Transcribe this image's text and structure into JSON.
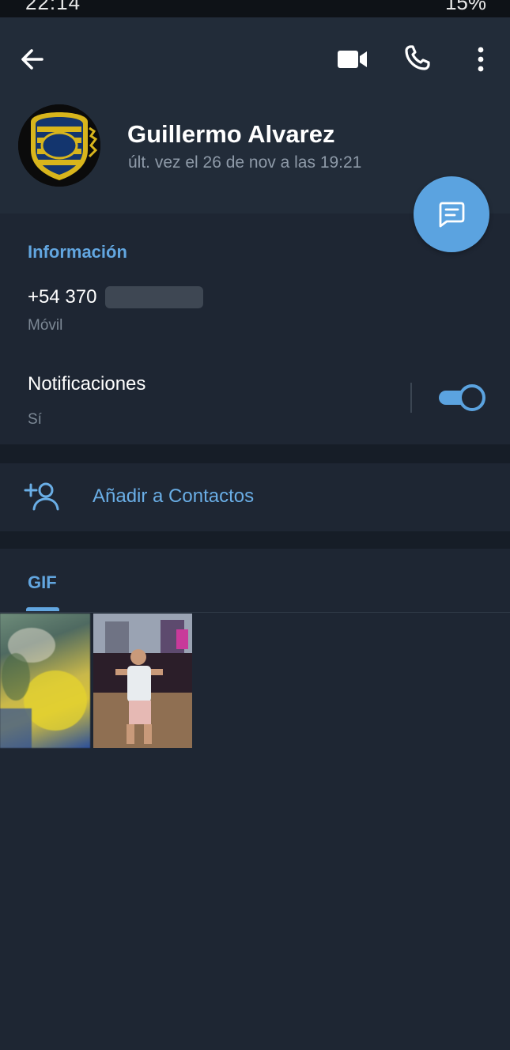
{
  "status_bar": {
    "time": "22:14",
    "battery": "15%"
  },
  "header": {
    "contact_name": "Guillermo Alvarez",
    "last_seen": "últ. vez el 26 de nov a las 19:21",
    "avatar_icon": "rosario-central-crest-icon"
  },
  "info": {
    "section_title": "Información",
    "phone_visible": "+54 370",
    "phone_label": "Móvil",
    "notifications_title": "Notificaciones",
    "notifications_value": "Sí",
    "notifications_enabled": true
  },
  "actions": {
    "add_contact_label": "Añadir a Contactos"
  },
  "media": {
    "tabs": [
      {
        "label": "GIF",
        "active": true
      }
    ],
    "items": [
      {
        "type": "gif"
      },
      {
        "type": "gif"
      }
    ]
  },
  "colors": {
    "accent": "#5ba3e0",
    "background": "#1e2633",
    "header": "#222c39",
    "section_gap": "#161d27"
  }
}
